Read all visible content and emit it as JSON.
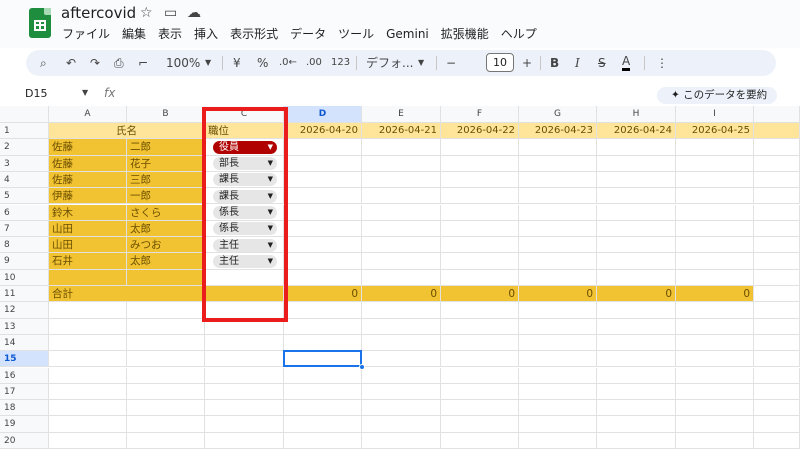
{
  "app": {
    "title": "aftercovid",
    "menu": [
      "ファイル",
      "編集",
      "表示",
      "挿入",
      "表示形式",
      "データ",
      "ツール",
      "Gemini",
      "拡張機能",
      "ヘルプ"
    ]
  },
  "toolbar": {
    "zoom": "100%",
    "currency": "¥",
    "percent": "%",
    "dec_decrease": ".0←",
    "dec_increase": ".00",
    "number_format": "123",
    "font": "デフォ...",
    "font_size": "10",
    "bold": "B",
    "italic": "I",
    "strike": "S",
    "text_color": "A"
  },
  "formula_bar": {
    "name_box": "D15",
    "fx": "fx",
    "summarize": "このデータを要約"
  },
  "sheet": {
    "columns": [
      "A",
      "B",
      "C",
      "D",
      "E",
      "F",
      "G",
      "H",
      "I"
    ],
    "rows": [
      "1",
      "2",
      "3",
      "4",
      "5",
      "6",
      "7",
      "8",
      "9",
      "10",
      "11",
      "12",
      "13",
      "14",
      "15",
      "16",
      "17",
      "18",
      "19",
      "20"
    ],
    "header_name": "氏名",
    "header_position": "職位",
    "dates": [
      "2026-04-20",
      "2026-04-21",
      "2026-04-22",
      "2026-04-23",
      "2026-04-24",
      "2026-04-25"
    ],
    "people": [
      {
        "last": "佐藤",
        "first": "二郎",
        "position": "役員"
      },
      {
        "last": "佐藤",
        "first": "花子",
        "position": "部長"
      },
      {
        "last": "佐藤",
        "first": "三郎",
        "position": "課長"
      },
      {
        "last": "伊藤",
        "first": "一郎",
        "position": "課長"
      },
      {
        "last": "鈴木",
        "first": "さくら",
        "position": "係長"
      },
      {
        "last": "山田",
        "first": "太郎",
        "position": "係長"
      },
      {
        "last": "山田",
        "first": "みつお",
        "position": "主任"
      },
      {
        "last": "石井",
        "first": "太郎",
        "position": "主任"
      }
    ],
    "total_label": "合計",
    "totals": [
      "0",
      "0",
      "0",
      "0",
      "0",
      "0"
    ],
    "selected_cell": "D15"
  },
  "colors": {
    "name_fill": "#f1c232",
    "header_fill": "#ffe599",
    "chip_red": "#b10202",
    "chip_gray": "#e6e6e6",
    "highlight_box": "#ea1c1c",
    "selection": "#1a73e8"
  }
}
